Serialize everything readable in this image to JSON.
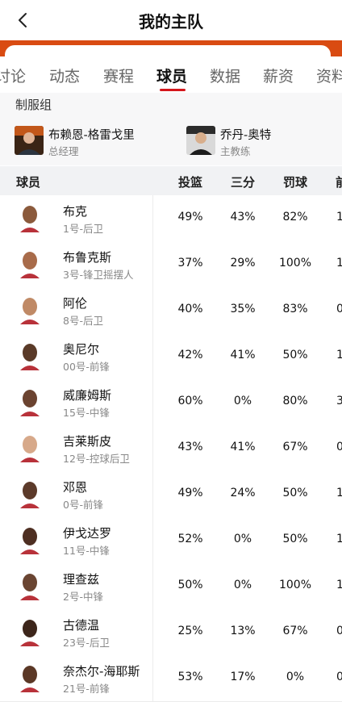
{
  "header": {
    "title": "我的主队"
  },
  "tabs": [
    {
      "label": "讨论"
    },
    {
      "label": "动态"
    },
    {
      "label": "赛程"
    },
    {
      "label": "球员"
    },
    {
      "label": "数据"
    },
    {
      "label": "薪资"
    },
    {
      "label": "资料"
    }
  ],
  "staff_section": {
    "title": "制服组",
    "members": [
      {
        "name": "布赖恩-格雷戈里",
        "role": "总经理"
      },
      {
        "name": "乔丹-奥特",
        "role": "主教练"
      }
    ]
  },
  "table": {
    "headers": [
      "球员",
      "投篮",
      "三分",
      "罚球",
      "前"
    ],
    "rows": [
      {
        "name": "布克",
        "info": "1号-后卫",
        "fg": "49%",
        "tp": "43%",
        "ft": "82%",
        "extra": "1"
      },
      {
        "name": "布鲁克斯",
        "info": "3号-锋卫摇摆人",
        "fg": "37%",
        "tp": "29%",
        "ft": "100%",
        "extra": "1"
      },
      {
        "name": "阿伦",
        "info": "8号-后卫",
        "fg": "40%",
        "tp": "35%",
        "ft": "83%",
        "extra": "0"
      },
      {
        "name": "奥尼尔",
        "info": "00号-前锋",
        "fg": "42%",
        "tp": "41%",
        "ft": "50%",
        "extra": "1"
      },
      {
        "name": "威廉姆斯",
        "info": "15号-中锋",
        "fg": "60%",
        "tp": "0%",
        "ft": "80%",
        "extra": "3"
      },
      {
        "name": "吉莱斯皮",
        "info": "12号-控球后卫",
        "fg": "43%",
        "tp": "41%",
        "ft": "67%",
        "extra": "0"
      },
      {
        "name": "邓恩",
        "info": "0号-前锋",
        "fg": "49%",
        "tp": "24%",
        "ft": "50%",
        "extra": "1"
      },
      {
        "name": "伊戈达罗",
        "info": "11号-中锋",
        "fg": "52%",
        "tp": "0%",
        "ft": "50%",
        "extra": "1"
      },
      {
        "name": "理查兹",
        "info": "2号-中锋",
        "fg": "50%",
        "tp": "0%",
        "ft": "100%",
        "extra": "1"
      },
      {
        "name": "古德温",
        "info": "23号-后卫",
        "fg": "25%",
        "tp": "13%",
        "ft": "67%",
        "extra": "0"
      },
      {
        "name": "奈杰尔-海耶斯",
        "info": "21号-前锋",
        "fg": "53%",
        "tp": "17%",
        "ft": "0%",
        "extra": "0"
      }
    ]
  },
  "colors": {
    "accent": "#d94b12",
    "active_tab_indicator": "#d4161b"
  },
  "icons": {
    "back": "chevron-left-icon"
  }
}
